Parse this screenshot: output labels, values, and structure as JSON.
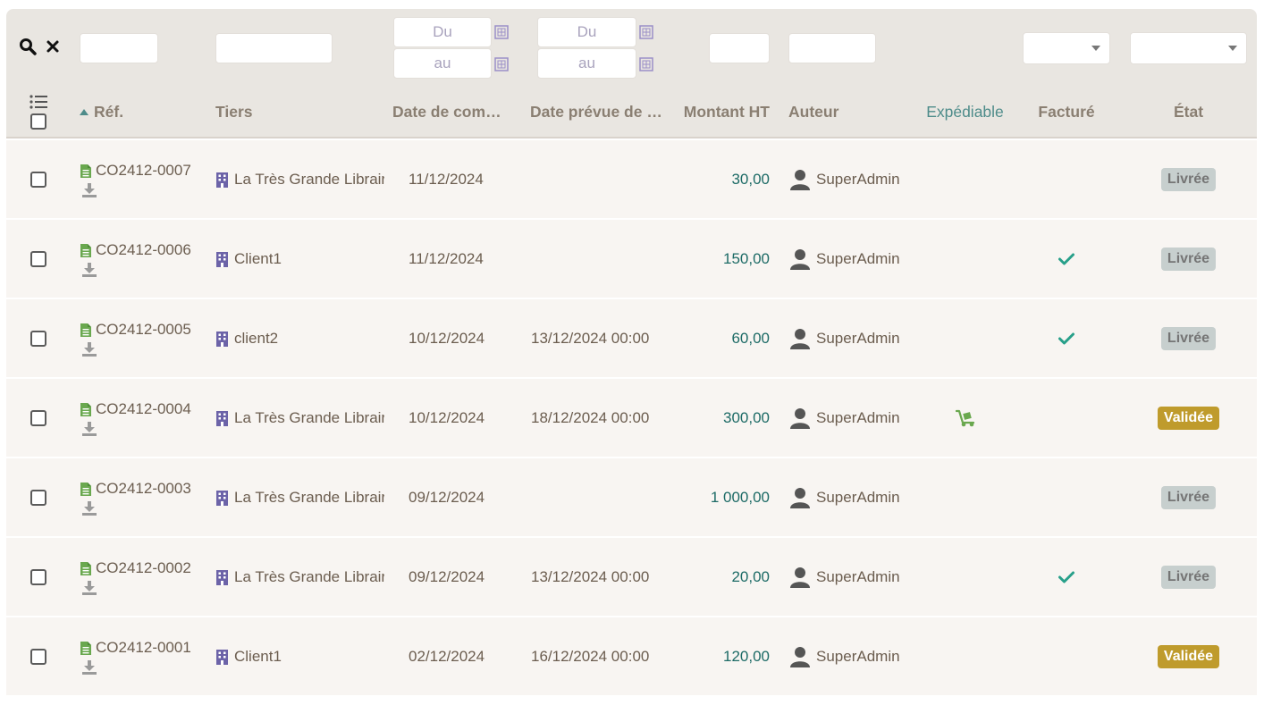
{
  "filters": {
    "date_commande_from_placeholder": "Du",
    "date_commande_to_placeholder": "au",
    "date_livraison_from_placeholder": "Du",
    "date_livraison_to_placeholder": "au"
  },
  "columns": {
    "ref": "Réf.",
    "tiers": "Tiers",
    "date_commande": "Date de commande",
    "date_livraison": "Date prévue de livraison",
    "montant": "Montant HT",
    "auteur": "Auteur",
    "expediable": "Expédiable",
    "facture": "Facturé",
    "etat": "État"
  },
  "icons": {
    "search": "search-icon",
    "clear": "close-icon",
    "columns": "list-icon",
    "document": "document-icon",
    "download": "download-icon",
    "company": "building-icon",
    "user": "user-icon",
    "check": "check-icon",
    "dolly": "dolly-icon",
    "calendar": "calendar-icon"
  },
  "colors": {
    "status_livree_bg": "#c7cfce",
    "status_validee_bg": "#bf9b2c",
    "amount": "#1d6b66",
    "check": "#28a08a",
    "document_icon": "#6aa84f",
    "company_icon": "#6c63a8"
  },
  "rows": [
    {
      "ref": "CO2412-0007",
      "tiers": "La Très Grande Librairie",
      "date_commande": "11/12/2024",
      "date_livraison": "",
      "montant": "30,00",
      "auteur": "SuperAdmin",
      "expediable": false,
      "facture": false,
      "etat": "Livrée",
      "etat_type": "livree"
    },
    {
      "ref": "CO2412-0006",
      "tiers": "Client1",
      "date_commande": "11/12/2024",
      "date_livraison": "",
      "montant": "150,00",
      "auteur": "SuperAdmin",
      "expediable": false,
      "facture": true,
      "etat": "Livrée",
      "etat_type": "livree"
    },
    {
      "ref": "CO2412-0005",
      "tiers": "client2",
      "date_commande": "10/12/2024",
      "date_livraison": "13/12/2024 00:00",
      "montant": "60,00",
      "auteur": "SuperAdmin",
      "expediable": false,
      "facture": true,
      "etat": "Livrée",
      "etat_type": "livree"
    },
    {
      "ref": "CO2412-0004",
      "tiers": "La Très Grande Librairie",
      "date_commande": "10/12/2024",
      "date_livraison": "18/12/2024 00:00",
      "montant": "300,00",
      "auteur": "SuperAdmin",
      "expediable": true,
      "facture": false,
      "etat": "Validée",
      "etat_type": "validee"
    },
    {
      "ref": "CO2412-0003",
      "tiers": "La Très Grande Librairie",
      "date_commande": "09/12/2024",
      "date_livraison": "",
      "montant": "1 000,00",
      "auteur": "SuperAdmin",
      "expediable": false,
      "facture": false,
      "etat": "Livrée",
      "etat_type": "livree"
    },
    {
      "ref": "CO2412-0002",
      "tiers": "La Très Grande Librairie",
      "date_commande": "09/12/2024",
      "date_livraison": "13/12/2024 00:00",
      "montant": "20,00",
      "auteur": "SuperAdmin",
      "expediable": false,
      "facture": true,
      "etat": "Livrée",
      "etat_type": "livree"
    },
    {
      "ref": "CO2412-0001",
      "tiers": "Client1",
      "date_commande": "02/12/2024",
      "date_livraison": "16/12/2024 00:00",
      "montant": "120,00",
      "auteur": "SuperAdmin",
      "expediable": false,
      "facture": false,
      "etat": "Validée",
      "etat_type": "validee"
    }
  ]
}
